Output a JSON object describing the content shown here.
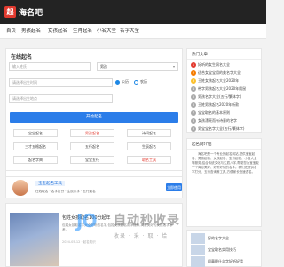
{
  "header": {
    "logo_mark": "起",
    "logo_text": "海名吧"
  },
  "nav": [
    "首页",
    "男孩起名",
    "女孩起名",
    "生肖起名",
    "小名大全",
    "名字大全"
  ],
  "form": {
    "title": "在线起名",
    "surname_placeholder": "输入姓氏",
    "gender_value": "男孩",
    "birthdate_placeholder": "请选择出生时间",
    "birthplace_placeholder": "请选择出生地点",
    "radio_options": [
      "公历",
      "农历"
    ],
    "submit_label": "开始起名"
  },
  "grid": [
    [
      "宝宝起名",
      "男孩起名",
      "诗词起名"
    ],
    [
      "三才五格起名",
      "五行起名",
      "生辰起名"
    ],
    [
      "起名字典",
      "宝宝五行",
      "取名工具"
    ]
  ],
  "promo": {
    "title": "宝宝起名工具",
    "subtitle": "在线取名 · 名字打分 · 生辰八字 · 五行起名",
    "button": "立即使用"
  },
  "article": {
    "title": "包姓女孩取名100分起年",
    "desc": "包姓女孩取名字大全好听的名字,包姓女孩起名用字推荐,寓意美好的女孩名字参考。",
    "meta": "2024-05-12 · 起名知识"
  },
  "sidebar_rank": {
    "heading": "热门文章",
    "items": [
      "好听的女生网名大全",
      "适合女宝宝用的美名字大全",
      "王姓女孩起名大全2020年",
      "带字男孩起名大全2020年属鼠",
      "男孩名字大全(五行/繁体字)",
      "王姓男孩起名2020年新款",
      "宝宝取名的基本原则",
      "女孩漂亮而有诗意的名字",
      "男宝宝名字大全(五行/繁体字)"
    ]
  },
  "sidebar_intro": {
    "heading": "起名网介绍",
    "text": "海名吧是一个专业的起名网站,提供宝宝起名、男孩起名、女孩起名、生肖起名、小名大全等服务,结合传统文化与生辰八字,帮助您为宝宝取一个寓意美好、好听好记的名字。我们还提供名字打分、五行查询等工具,方便家长快速选名。"
  },
  "sidebar_more": [
    "好的名字大全",
    "宝宝取名实用技巧",
    "印章配什么字好听好看"
  ],
  "watermark": {
    "glyph": "JO",
    "text": "自动秒收录",
    "sub": "收录 · 采 · 取 · 给"
  }
}
